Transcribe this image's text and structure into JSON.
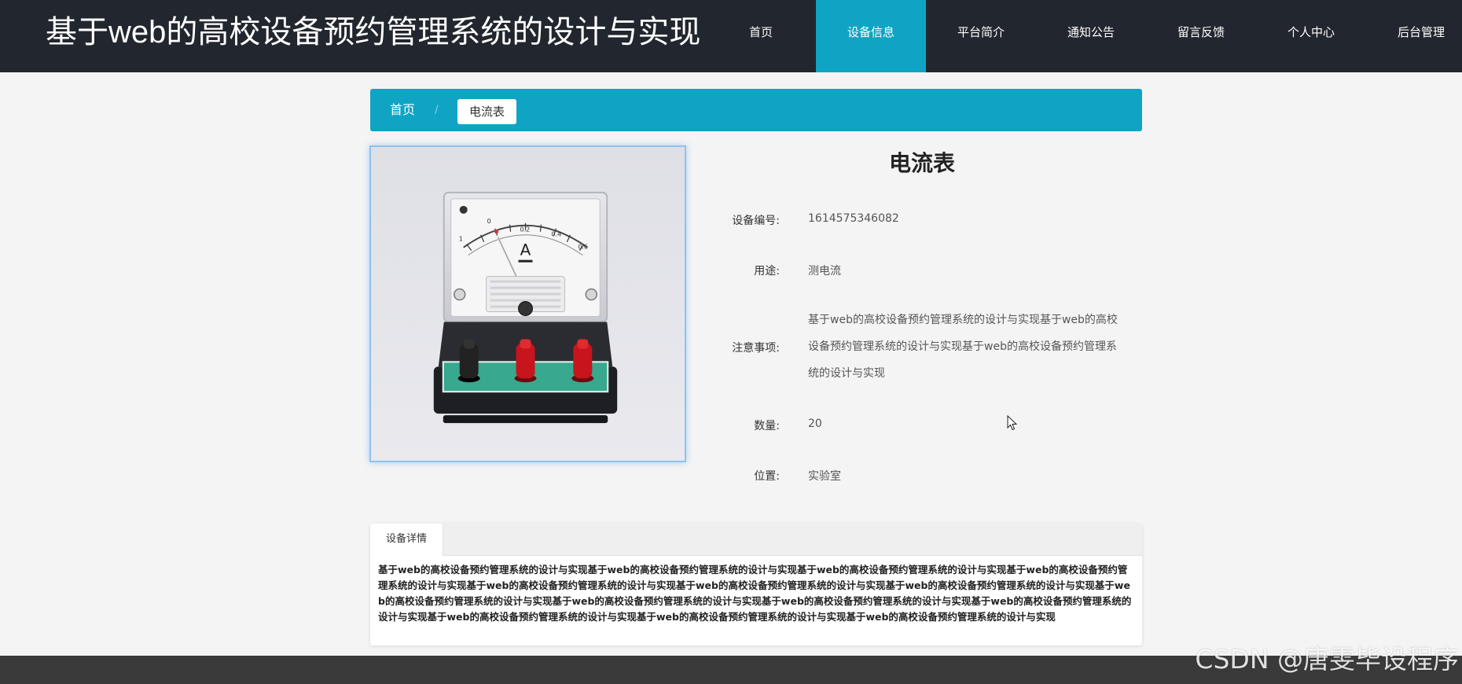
{
  "header": {
    "site_title": "基于web的高校设备预约管理系统的设计与实现",
    "nav": [
      {
        "label": "首页",
        "active": false
      },
      {
        "label": "设备信息",
        "active": true
      },
      {
        "label": "平台简介",
        "active": false
      },
      {
        "label": "通知公告",
        "active": false
      },
      {
        "label": "留言反馈",
        "active": false
      },
      {
        "label": "个人中心",
        "active": false
      },
      {
        "label": "后台管理",
        "active": false
      }
    ]
  },
  "breadcrumb": {
    "home": "首页",
    "separator": "/",
    "current": "电流表"
  },
  "product_image": {
    "icon": "ammeter-image",
    "dial_letter": "A",
    "scale_labels": [
      "1",
      "0",
      "0.2",
      "0.4",
      "0.6"
    ]
  },
  "detail": {
    "title": "电流表",
    "rows": {
      "code": {
        "label": "设备编号:",
        "value": "1614575346082"
      },
      "usage": {
        "label": "用途:",
        "value": "测电流"
      },
      "notes": {
        "label": "注意事项:",
        "lines": [
          "基于web的高校设备预约管理系统的设计与实现基于web的高校",
          "设备预约管理系统的设计与实现基于web的高校设备预约管理系",
          "统的设计与实现"
        ]
      },
      "quantity": {
        "label": "数量:",
        "value": "20"
      },
      "location": {
        "label": "位置:",
        "value": "实验室"
      }
    }
  },
  "tabs": {
    "active_tab": "设备详情",
    "content": "基于web的高校设备预约管理系统的设计与实现基于web的高校设备预约管理系统的设计与实现基于web的高校设备预约管理系统的设计与实现基于web的高校设备预约管理系统的设计与实现基于web的高校设备预约管理系统的设计与实现基于web的高校设备预约管理系统的设计与实现基于web的高校设备预约管理系统的设计与实现基于web的高校设备预约管理系统的设计与实现基于web的高校设备预约管理系统的设计与实现基于web的高校设备预约管理系统的设计与实现基于web的高校设备预约管理系统的设计与实现基于web的高校设备预约管理系统的设计与实现基于web的高校设备预约管理系统的设计与实现基于web的高校设备预约管理系统的设计与实现"
  },
  "watermark": "CSDN @唐雯毕设程序",
  "colors": {
    "header_bg": "#22262e",
    "accent": "#0fa4c4",
    "footer_bg": "#3a3a3a"
  }
}
